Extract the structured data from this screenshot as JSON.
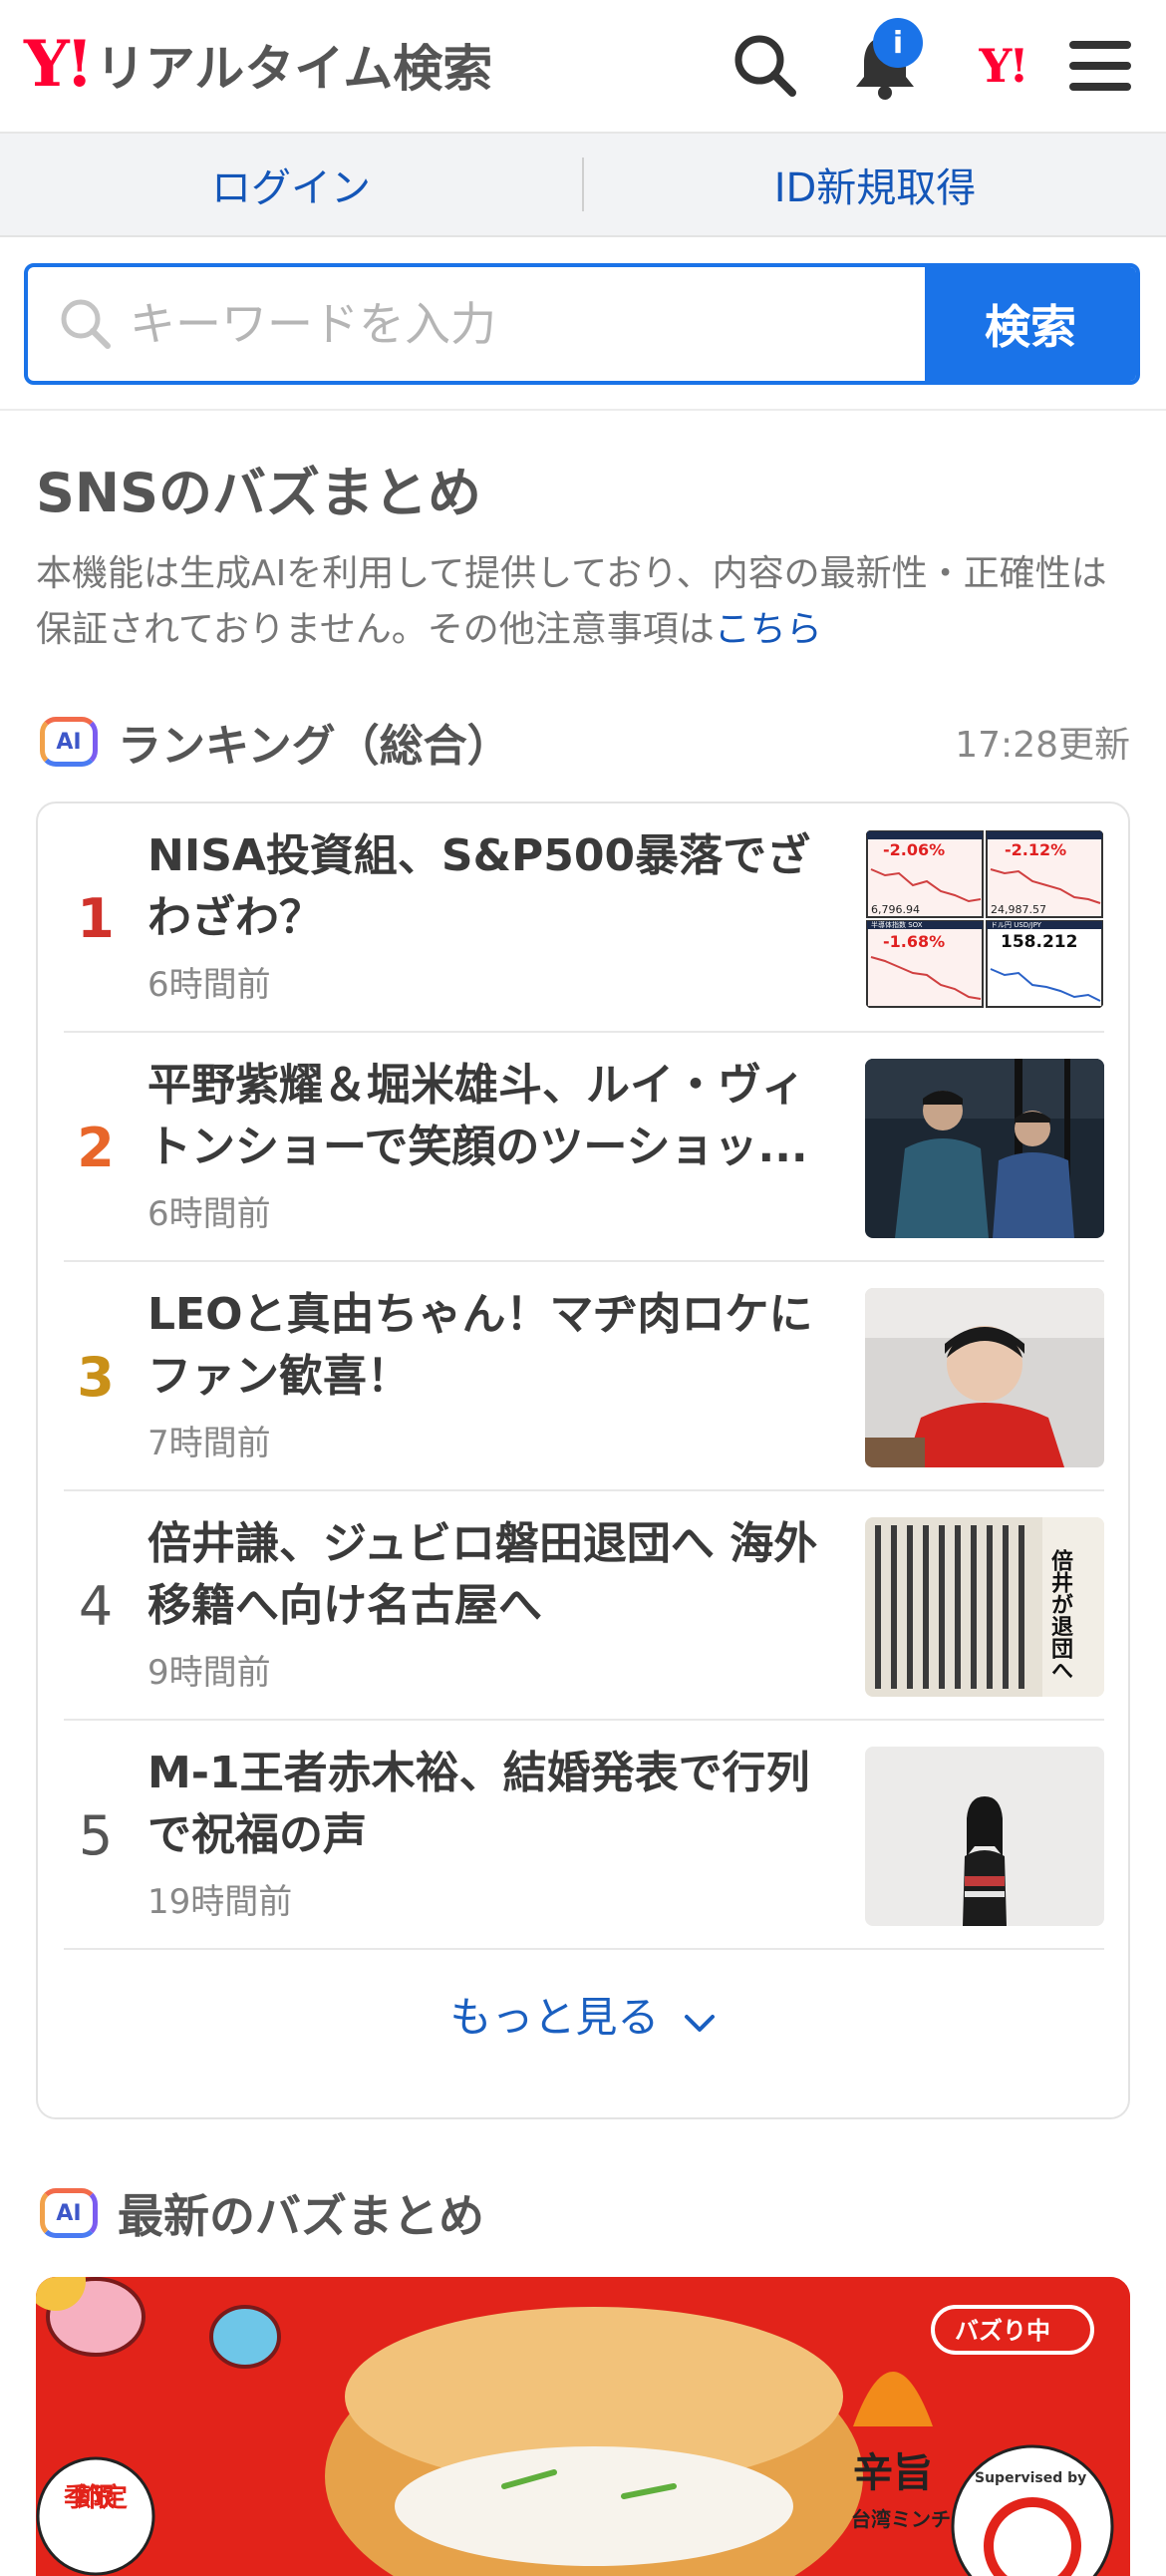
{
  "header": {
    "logo_mark": "Y!",
    "logo_text": "リアルタイム検索",
    "notification_badge": "i",
    "yahoo_mark": "Y!"
  },
  "account": {
    "login": "ログイン",
    "register": "ID新規取得"
  },
  "search": {
    "placeholder": "キーワードを入力",
    "button": "検索"
  },
  "sns": {
    "title": "SNSのバズまとめ",
    "notice": "本機能は生成AIを利用して提供しており、内容の最新性・正確性は保証されておりません。その他注意事項は",
    "notice_link": "こちら"
  },
  "ranking": {
    "ai_label": "AI",
    "title": "ランキング（総合）",
    "updated": "17:28更新",
    "items": [
      {
        "rank": "1",
        "title": "NISA投資組、S&P500暴落でざわざわ？",
        "time": "6時間前",
        "rank_color": "#d0322b",
        "thumb": "stock-chart",
        "thumb_text": {
          "v1": "-2.06%",
          "v2": "-2.12%",
          "v3": "-1.68%",
          "v4": "158.212",
          "p1": "6,796.94",
          "p2": "24,987.57",
          "l3": "半導体指数 SOX",
          "l4": "ドル円 USD/JPY"
        }
      },
      {
        "rank": "2",
        "title": "平野紫耀＆堀米雄斗、ルイ・ヴィトンショーで笑顔のツーショッ...",
        "time": "6時間前",
        "rank_color": "#e8662a",
        "thumb": "photo-two-men"
      },
      {
        "rank": "3",
        "title": "LEOと真由ちゃん！マヂ肉ロケにファン歓喜！",
        "time": "7時間前",
        "rank_color": "#c99018",
        "thumb": "photo-red-sweater"
      },
      {
        "rank": "4",
        "title": "倍井謙、ジュビロ磐田退団へ 海外移籍へ向け名古屋へ",
        "time": "9時間前",
        "rank_color": "#555555",
        "thumb": "newspaper",
        "thumb_text": {
          "headline": "倍井が退団へ"
        }
      },
      {
        "rank": "5",
        "title": "M-1王者赤木裕、結婚発表で行列で祝福の声",
        "time": "19時間前",
        "rank_color": "#555555",
        "thumb": "photo-woman"
      }
    ],
    "more": "もっと見る"
  },
  "latest": {
    "ai_label": "AI",
    "title": "最新のバズまとめ",
    "banner": {
      "tag": "バズり中",
      "season": "季節限定",
      "spicy": "辛旨",
      "sub": "台湾ミンチ",
      "supervised": "Supervised by"
    }
  },
  "colors": {
    "brand_red": "#ff0033",
    "accent_blue": "#1a73e8",
    "link_blue": "#1456b8"
  }
}
